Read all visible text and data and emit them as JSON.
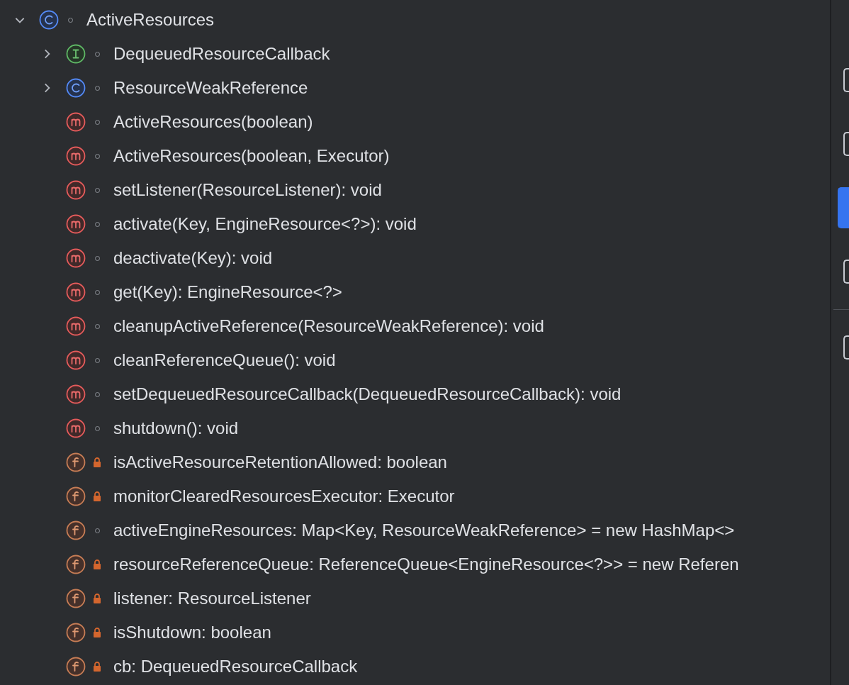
{
  "tree": [
    {
      "label": "ActiveResources",
      "kind": "class",
      "private": false,
      "expanded": true,
      "children": [
        {
          "label": "DequeuedResourceCallback",
          "kind": "interface",
          "private": false,
          "expanded": false
        },
        {
          "label": "ResourceWeakReference",
          "kind": "class",
          "private": false,
          "expanded": false
        },
        {
          "label": "ActiveResources(boolean)",
          "kind": "method",
          "private": false
        },
        {
          "label": "ActiveResources(boolean, Executor)",
          "kind": "method",
          "private": false
        },
        {
          "label": "setListener(ResourceListener): void",
          "kind": "method",
          "private": false
        },
        {
          "label": "activate(Key, EngineResource<?>): void",
          "kind": "method",
          "private": false
        },
        {
          "label": "deactivate(Key): void",
          "kind": "method",
          "private": false
        },
        {
          "label": "get(Key): EngineResource<?>",
          "kind": "method",
          "private": false
        },
        {
          "label": "cleanupActiveReference(ResourceWeakReference): void",
          "kind": "method",
          "private": false
        },
        {
          "label": "cleanReferenceQueue(): void",
          "kind": "method",
          "private": false
        },
        {
          "label": "setDequeuedResourceCallback(DequeuedResourceCallback): void",
          "kind": "method",
          "private": false
        },
        {
          "label": "shutdown(): void",
          "kind": "method",
          "private": false
        },
        {
          "label": "isActiveResourceRetentionAllowed: boolean",
          "kind": "field",
          "private": true
        },
        {
          "label": "monitorClearedResourcesExecutor: Executor",
          "kind": "field",
          "private": true
        },
        {
          "label": "activeEngineResources: Map<Key, ResourceWeakReference> = new HashMap<>",
          "kind": "field",
          "private": false
        },
        {
          "label": "resourceReferenceQueue: ReferenceQueue<EngineResource<?>> = new Referen",
          "kind": "field",
          "private": true
        },
        {
          "label": "listener: ResourceListener",
          "kind": "field",
          "private": true
        },
        {
          "label": "isShutdown: boolean",
          "kind": "field",
          "private": true
        },
        {
          "label": "cb: DequeuedResourceCallback",
          "kind": "field",
          "private": true
        }
      ]
    }
  ],
  "toolbar": [
    {
      "selected": false
    },
    {
      "selected": false
    },
    {
      "selected": true
    },
    {
      "selected": false
    },
    {
      "selected": false
    }
  ]
}
